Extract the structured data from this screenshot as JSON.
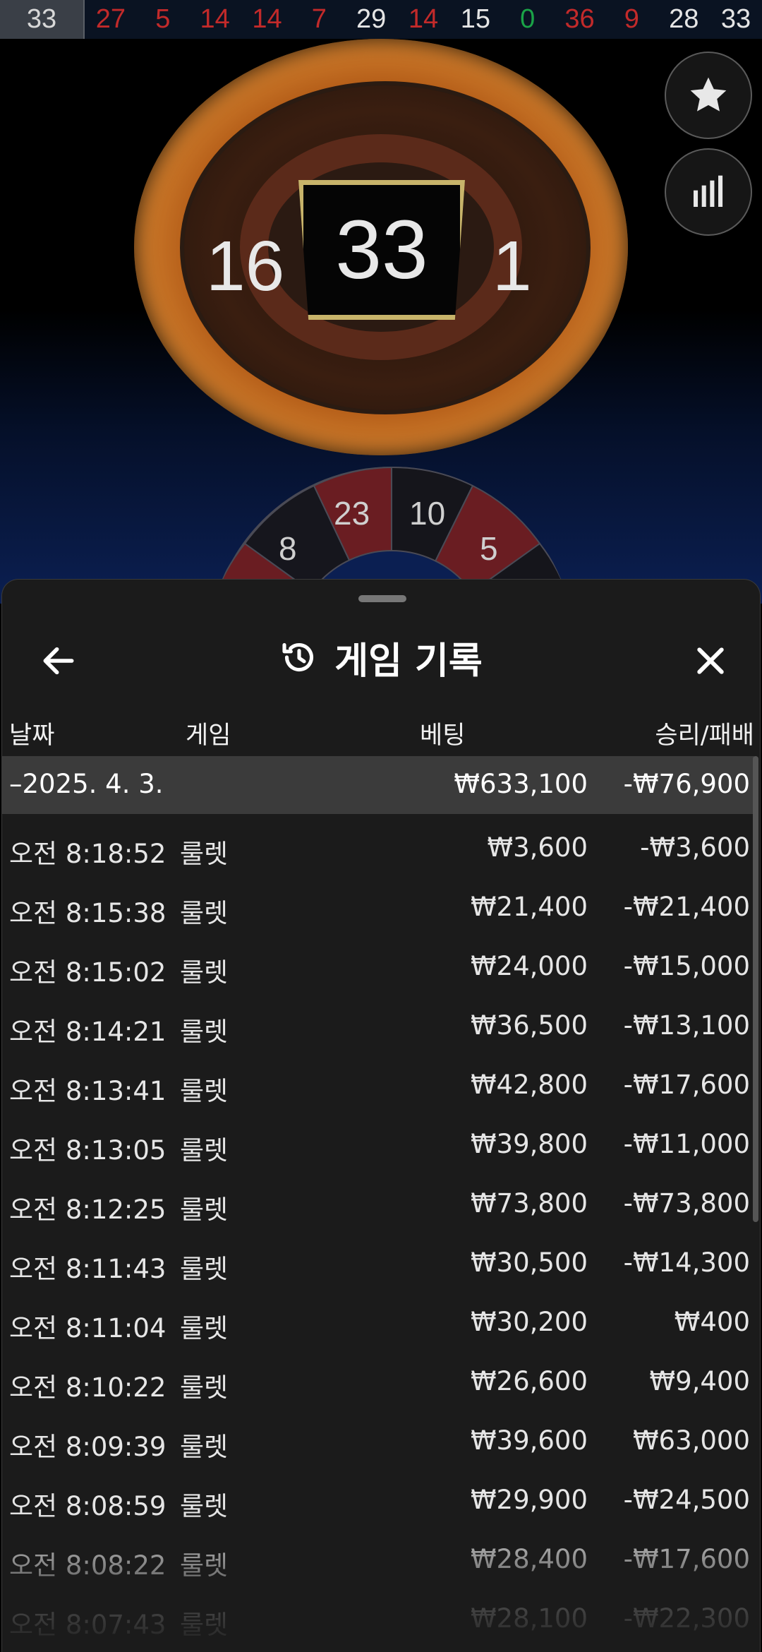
{
  "history_strip": [
    {
      "value": "33",
      "color": "black"
    },
    {
      "value": "27",
      "color": "red"
    },
    {
      "value": "5",
      "color": "red"
    },
    {
      "value": "14",
      "color": "red"
    },
    {
      "value": "14",
      "color": "red"
    },
    {
      "value": "7",
      "color": "red"
    },
    {
      "value": "29",
      "color": "black"
    },
    {
      "value": "14",
      "color": "red"
    },
    {
      "value": "15",
      "color": "black"
    },
    {
      "value": "0",
      "color": "green"
    },
    {
      "value": "36",
      "color": "red"
    },
    {
      "value": "9",
      "color": "red"
    },
    {
      "value": "28",
      "color": "black"
    },
    {
      "value": "33",
      "color": "black"
    }
  ],
  "wheel": {
    "result": "33",
    "left_neighbor": "16",
    "right_neighbor": "1"
  },
  "racetrack": {
    "segments": [
      "8",
      "23",
      "10",
      "5"
    ]
  },
  "side_buttons": {
    "favorite_icon": "star-icon",
    "stats_icon": "bar-chart-icon"
  },
  "sheet": {
    "title": "게임 기록",
    "title_icon": "history-icon",
    "back_icon": "arrow-left-icon",
    "close_icon": "close-icon",
    "columns": {
      "date": "날짜",
      "game": "게임",
      "bet": "베팅",
      "result": "승리/패배"
    },
    "date_group": {
      "date": "–2025. 4. 3.",
      "total_bet": "₩633,100",
      "total_result": "-₩76,900"
    },
    "rows": [
      {
        "time": "오전 8:18:52",
        "game": "룰렛",
        "bet": "₩3,600",
        "result": "-₩3,600"
      },
      {
        "time": "오전 8:15:38",
        "game": "룰렛",
        "bet": "₩21,400",
        "result": "-₩21,400"
      },
      {
        "time": "오전 8:15:02",
        "game": "룰렛",
        "bet": "₩24,000",
        "result": "-₩15,000"
      },
      {
        "time": "오전 8:14:21",
        "game": "룰렛",
        "bet": "₩36,500",
        "result": "-₩13,100"
      },
      {
        "time": "오전 8:13:41",
        "game": "룰렛",
        "bet": "₩42,800",
        "result": "-₩17,600"
      },
      {
        "time": "오전 8:13:05",
        "game": "룰렛",
        "bet": "₩39,800",
        "result": "-₩11,000"
      },
      {
        "time": "오전 8:12:25",
        "game": "룰렛",
        "bet": "₩73,800",
        "result": "-₩73,800"
      },
      {
        "time": "오전 8:11:43",
        "game": "룰렛",
        "bet": "₩30,500",
        "result": "-₩14,300"
      },
      {
        "time": "오전 8:11:04",
        "game": "룰렛",
        "bet": "₩30,200",
        "result": "₩400"
      },
      {
        "time": "오전 8:10:22",
        "game": "룰렛",
        "bet": "₩26,600",
        "result": "₩9,400"
      },
      {
        "time": "오전 8:09:39",
        "game": "룰렛",
        "bet": "₩39,600",
        "result": "₩63,000"
      },
      {
        "time": "오전 8:08:59",
        "game": "룰렛",
        "bet": "₩29,900",
        "result": "-₩24,500"
      },
      {
        "time": "오전 8:08:22",
        "game": "룰렛",
        "bet": "₩28,400",
        "result": "-₩17,600"
      },
      {
        "time": "오전 8:07:43",
        "game": "룰렛",
        "bet": "₩28,100",
        "result": "-₩22,300"
      }
    ]
  }
}
